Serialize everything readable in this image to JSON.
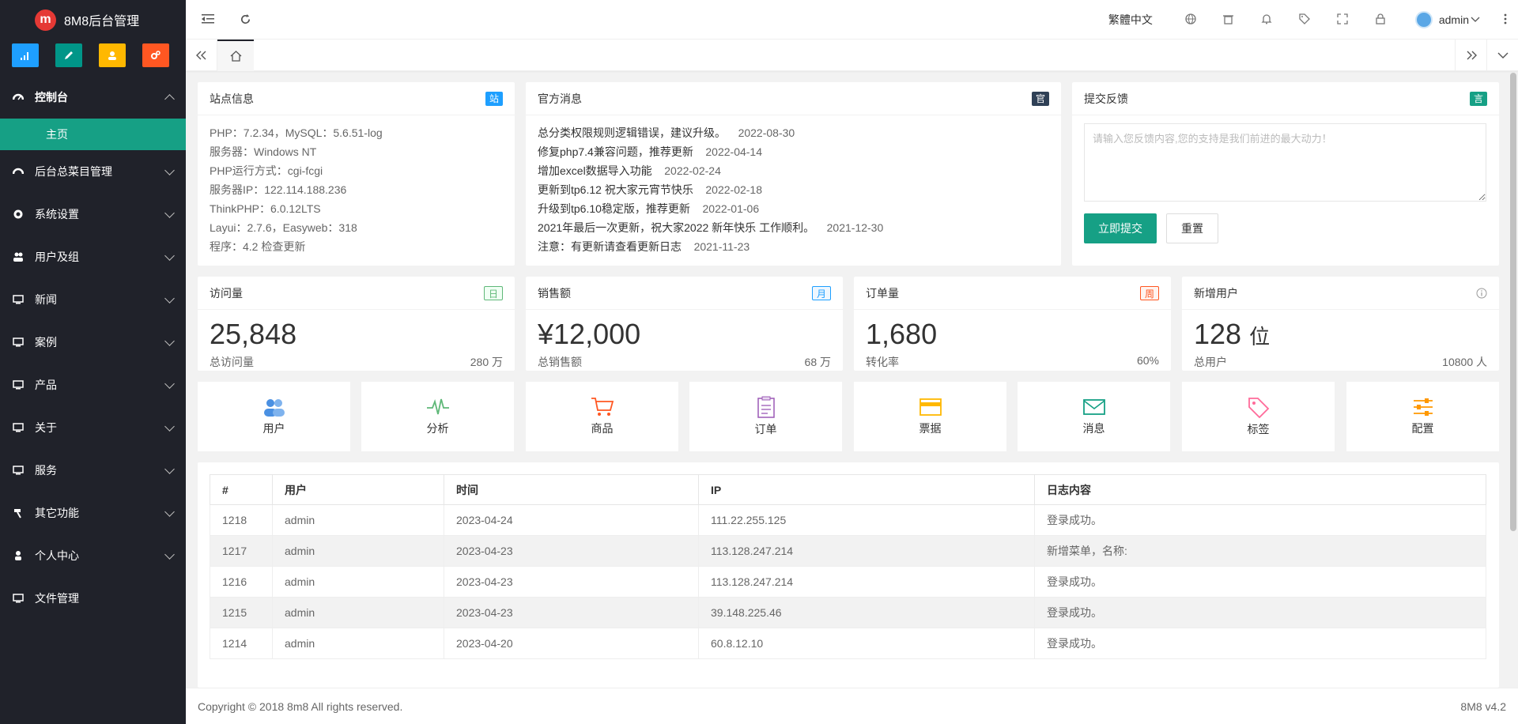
{
  "app": {
    "title": "8M8后台管理",
    "logo_letter": "m"
  },
  "sidebar": {
    "quick_icons": [
      {
        "name": "signal-icon",
        "color": "#1e9fff"
      },
      {
        "name": "pencil-icon",
        "color": "#009688"
      },
      {
        "name": "users-icon",
        "color": "#ffb800"
      },
      {
        "name": "gears-icon",
        "color": "#ff5722"
      }
    ],
    "items": [
      {
        "label": "控制台",
        "expanded": true,
        "children": [
          {
            "label": "主页"
          }
        ]
      },
      {
        "label": "后台总菜目管理"
      },
      {
        "label": "系统设置"
      },
      {
        "label": "用户及组"
      },
      {
        "label": "新闻"
      },
      {
        "label": "案例"
      },
      {
        "label": "产品"
      },
      {
        "label": "关于"
      },
      {
        "label": "服务"
      },
      {
        "label": "其它功能"
      },
      {
        "label": "个人中心"
      },
      {
        "label": "文件管理"
      }
    ]
  },
  "header": {
    "language": "繁體中文",
    "username": "admin"
  },
  "site_info": {
    "title": "站点信息",
    "badge": "站",
    "badge_color": "#1e9fff",
    "lines": [
      "PHP：7.2.34，MySQL：5.6.51-log",
      "服务器：Windows NT",
      "PHP运行方式：cgi-fcgi",
      "服务器IP：122.114.188.236",
      "ThinkPHP：6.0.12LTS",
      "Layui：2.7.6，Easyweb：318",
      "程序：4.2 检查更新"
    ]
  },
  "official_news": {
    "title": "官方消息",
    "badge": "官",
    "badge_color": "#2f4056",
    "items": [
      {
        "text": "总分类权限规则逻辑错误，建议升级。",
        "date": "2022-08-30"
      },
      {
        "text": "修复php7.4兼容问题，推荐更新",
        "date": "2022-04-14"
      },
      {
        "text": "增加excel数据导入功能",
        "date": "2022-02-24"
      },
      {
        "text": "更新到tp6.12 祝大家元宵节快乐",
        "date": "2022-02-18"
      },
      {
        "text": "升级到tp6.10稳定版，推荐更新",
        "date": "2022-01-06"
      },
      {
        "text": "2021年最后一次更新，祝大家2022 新年快乐 工作顺利。",
        "date": "2021-12-30"
      },
      {
        "text": "注意：有更新请查看更新日志",
        "date": "2021-11-23"
      }
    ]
  },
  "feedback": {
    "title": "提交反馈",
    "badge": "言",
    "badge_color": "#16a085",
    "placeholder": "请输入您反馈内容,您的支持是我们前进的最大动力！",
    "submit": "立即提交",
    "reset": "重置"
  },
  "stats": [
    {
      "title": "访问量",
      "badge": "日",
      "badge_color": "#5fb878",
      "value": "25,848",
      "unit": "",
      "label": "总访问量",
      "extra": "280 万"
    },
    {
      "title": "销售额",
      "badge": "月",
      "badge_color": "#1e9fff",
      "value": "¥12,000",
      "unit": "",
      "label": "总销售额",
      "extra": "68 万"
    },
    {
      "title": "订单量",
      "badge": "周",
      "badge_color": "#ff5722",
      "value": "1,680",
      "unit": "",
      "label": "转化率",
      "extra": "60%"
    },
    {
      "title": "新增用户",
      "badge": "",
      "badge_color": "#999",
      "value": "128",
      "unit": "位",
      "label": "总用户",
      "extra": "10800 人"
    }
  ],
  "shortcuts": [
    {
      "label": "用户",
      "icon": "users-icon",
      "color": "#4a90e2"
    },
    {
      "label": "分析",
      "icon": "pulse-icon",
      "color": "#5fb878"
    },
    {
      "label": "商品",
      "icon": "cart-icon",
      "color": "#ff5722"
    },
    {
      "label": "订单",
      "icon": "clipboard-icon",
      "color": "#9b59b6"
    },
    {
      "label": "票据",
      "icon": "card-icon",
      "color": "#ffb800"
    },
    {
      "label": "消息",
      "icon": "mail-icon",
      "color": "#16a085"
    },
    {
      "label": "标签",
      "icon": "tag-icon",
      "color": "#ff6b9a"
    },
    {
      "label": "配置",
      "icon": "sliders-icon",
      "color": "#ff9800"
    }
  ],
  "log_table": {
    "headers": [
      "#",
      "用户",
      "时间",
      "IP",
      "日志内容"
    ],
    "rows": [
      [
        "1218",
        "admin",
        "2023-04-24",
        "111.22.255.125",
        "登录成功。"
      ],
      [
        "1217",
        "admin",
        "2023-04-23",
        "113.128.247.214",
        "新增菜单，名称:"
      ],
      [
        "1216",
        "admin",
        "2023-04-23",
        "113.128.247.214",
        "登录成功。"
      ],
      [
        "1215",
        "admin",
        "2023-04-23",
        "39.148.225.46",
        "登录成功。"
      ],
      [
        "1214",
        "admin",
        "2023-04-20",
        "60.8.12.10",
        "登录成功。"
      ]
    ]
  },
  "footer": {
    "copyright": "Copyright © 2018 8m8 All rights reserved.",
    "version": "8M8 v4.2"
  }
}
